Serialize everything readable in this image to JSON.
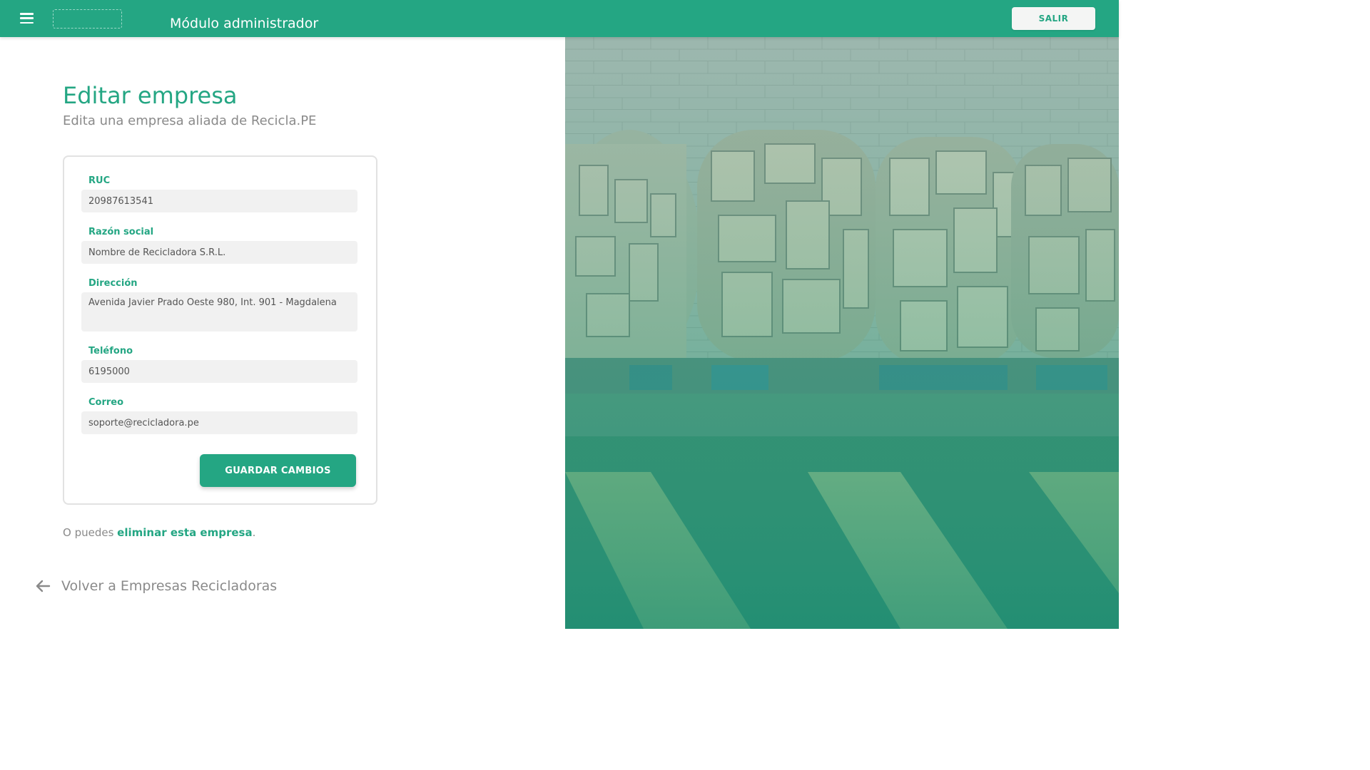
{
  "header": {
    "title": "Módulo administrador",
    "logout_label": "SALIR",
    "bg_color": "#24a683"
  },
  "page": {
    "title": "Editar empresa",
    "subtitle": "Edita una empresa aliada de Recicla.PE"
  },
  "form": {
    "ruc": {
      "label": "RUC",
      "value": "20987613541"
    },
    "business_name": {
      "label": "Razón social",
      "value": "Nombre de Recicladora S.R.L."
    },
    "address": {
      "label": "Dirección",
      "value": "Avenida Javier Prado Oeste 980, Int. 901 - Magdalena"
    },
    "phone": {
      "label": "Teléfono",
      "value": "6195000"
    },
    "email": {
      "label": "Correo",
      "value": "soporte@recicladora.pe"
    },
    "submit_label": "GUARDAR CAMBIOS"
  },
  "delete": {
    "prefix": "O puedes ",
    "link_label": "eliminar esta empresa",
    "suffix": "."
  },
  "back": {
    "label": "Volver a Empresas Recicladoras"
  },
  "hero_image": {
    "subject": "Baled cardboard on pallets with green overlay",
    "overlay_color": "#24a683"
  }
}
